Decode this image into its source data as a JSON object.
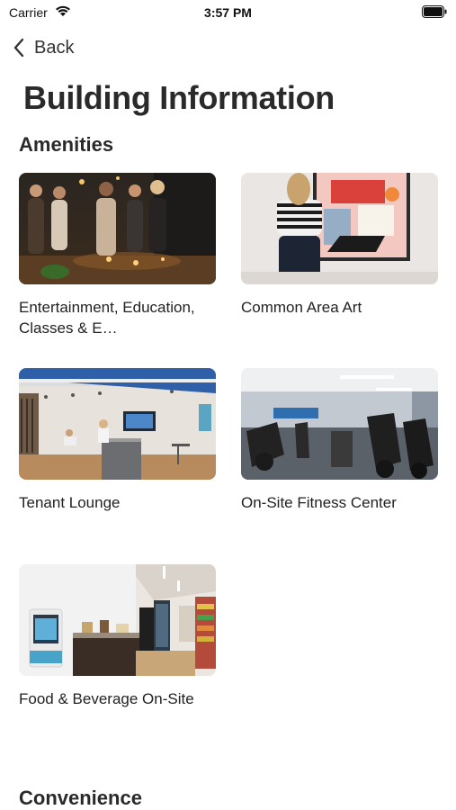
{
  "status_bar": {
    "carrier": "Carrier",
    "time": "3:57 PM",
    "icons": [
      "wifi-icon",
      "battery-icon"
    ]
  },
  "nav": {
    "back_label": "Back",
    "back_icon": "chevron-left-icon"
  },
  "page": {
    "title": "Building Information"
  },
  "sections": {
    "amenities": {
      "heading": "Amenities",
      "cards": [
        {
          "label": "Entertainment, Education, Classes & E…",
          "image": "people-socializing-photo"
        },
        {
          "label": "Common Area Art",
          "image": "woman-viewing-painting-photo"
        },
        {
          "label": "Tenant Lounge",
          "image": "lounge-room-photo"
        },
        {
          "label": "On-Site Fitness Center",
          "image": "gym-equipment-photo"
        },
        {
          "label": "Food & Beverage On-Site",
          "image": "market-kiosk-photo"
        }
      ]
    },
    "convenience": {
      "heading": "Convenience"
    }
  },
  "colors": {
    "text": "#222222",
    "heading": "#2a2a2a",
    "background": "#ffffff"
  }
}
